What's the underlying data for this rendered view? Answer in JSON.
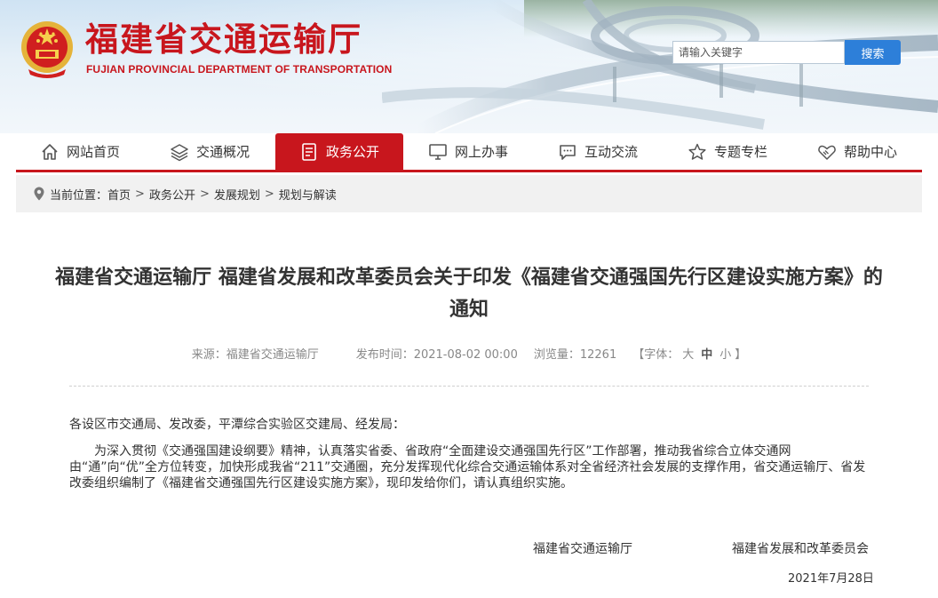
{
  "header": {
    "title": "福建省交通运输厅",
    "subtitle": "FUJIAN PROVINCIAL DEPARTMENT OF TRANSPORTATION",
    "emblem_icon": "national-emblem-icon",
    "search": {
      "placeholder": "请输入关键字",
      "button_label": "搜索"
    },
    "colors": {
      "brand_red": "#c8161d",
      "search_blue": "#2d7fd9"
    }
  },
  "nav": {
    "items": [
      {
        "label": "网站首页",
        "icon": "home-icon",
        "active": false
      },
      {
        "label": "交通概况",
        "icon": "layers-icon",
        "active": false
      },
      {
        "label": "政务公开",
        "icon": "document-icon",
        "active": true
      },
      {
        "label": "网上办事",
        "icon": "monitor-icon",
        "active": false
      },
      {
        "label": "互动交流",
        "icon": "chat-icon",
        "active": false
      },
      {
        "label": "专题专栏",
        "icon": "star-icon",
        "active": false
      },
      {
        "label": "帮助中心",
        "icon": "handshake-icon",
        "active": false
      }
    ]
  },
  "breadcrumb": {
    "prefix": "当前位置：",
    "items": [
      "首页",
      "政务公开",
      "发展规划",
      "规划与解读"
    ],
    "separator": ">"
  },
  "article": {
    "title": "福建省交通运输厅 福建省发展和改革委员会关于印发《福建省交通强国先行区建设实施方案》的通知",
    "meta": {
      "source": "来源：福建省交通运输厅",
      "published": "发布时间：2021-08-02 00:00",
      "views": "浏览量：12261",
      "font_size_label": "【字体：",
      "font_size_options": [
        "大",
        "中",
        "小"
      ],
      "font_size_close": "】"
    },
    "salutation": "各设区市交通局、发改委，平潭综合实验区交建局、经发局：",
    "paragraph": "为深入贯彻《交通强国建设纲要》精神，认真落实省委、省政府“全面建设交通强国先行区”工作部署，推动我省综合立体交通网由“通”向“优”全方位转变，加快形成我省“211”交通圈，充分发挥现代化综合交通运输体系对全省经济社会发展的支撑作用，省交通运输厅、省发改委组织编制了《福建省交通强国先行区建设实施方案》，现印发给你们，请认真组织实施。",
    "signatures": [
      "福建省交通运输厅",
      "福建省发展和改革委员会"
    ],
    "date": "2021年7月28日"
  }
}
